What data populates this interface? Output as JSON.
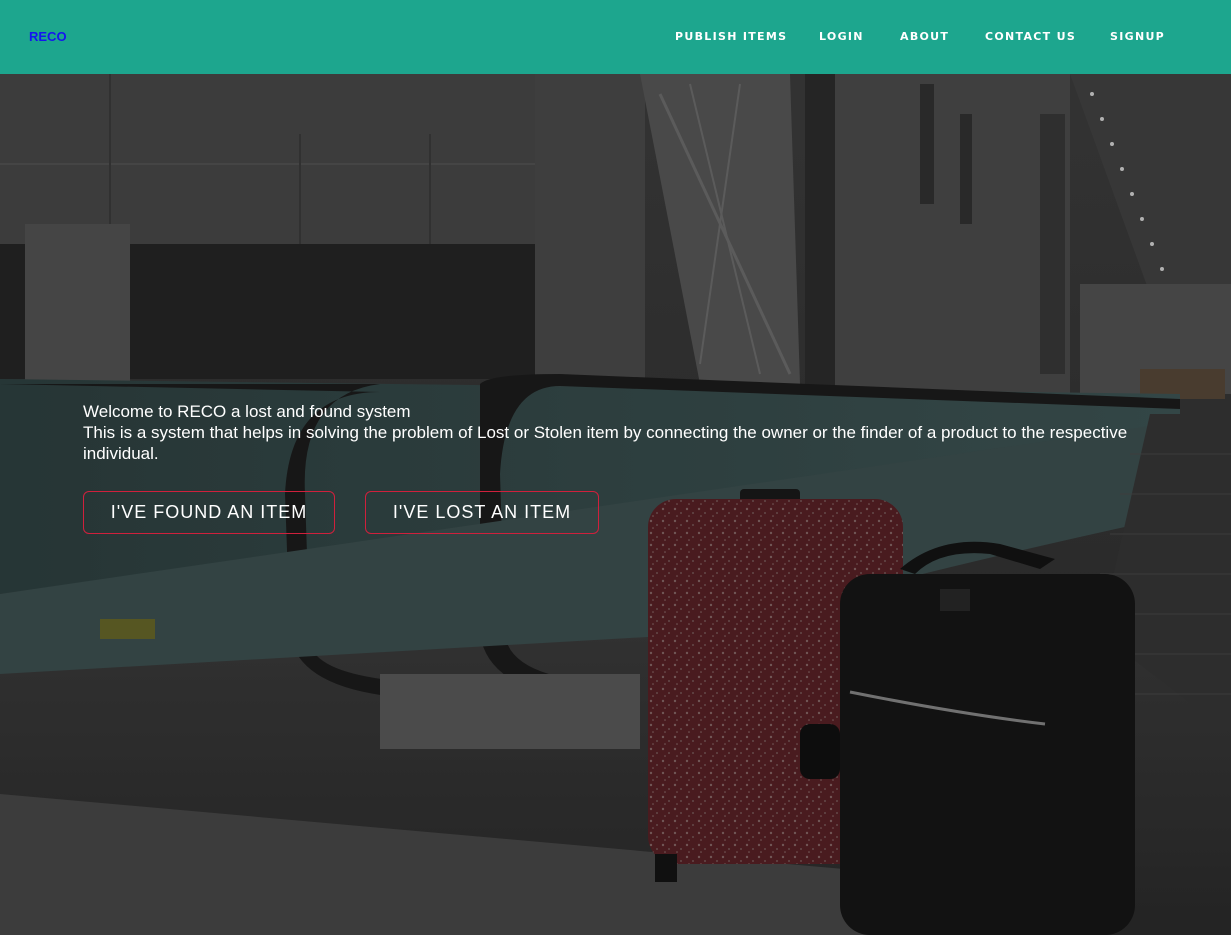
{
  "nav": {
    "brand": "RECO",
    "links": [
      "PUBLISH ITEMS",
      "LOGIN",
      "ABOUT",
      "CONTACT US",
      "SIGNUP"
    ]
  },
  "hero": {
    "title": "Welcome to RECO a lost and found system",
    "description": "This is a system that helps in solving the problem of Lost or Stolen item by connecting the owner or the finder of a product to the respective individual.",
    "buttons": {
      "found": "I'VE FOUND AN ITEM",
      "lost": "I'VE LOST AN ITEM"
    }
  },
  "colors": {
    "navbar": "#1da68e",
    "brand": "#1515f0",
    "button_border": "#d0203c"
  }
}
